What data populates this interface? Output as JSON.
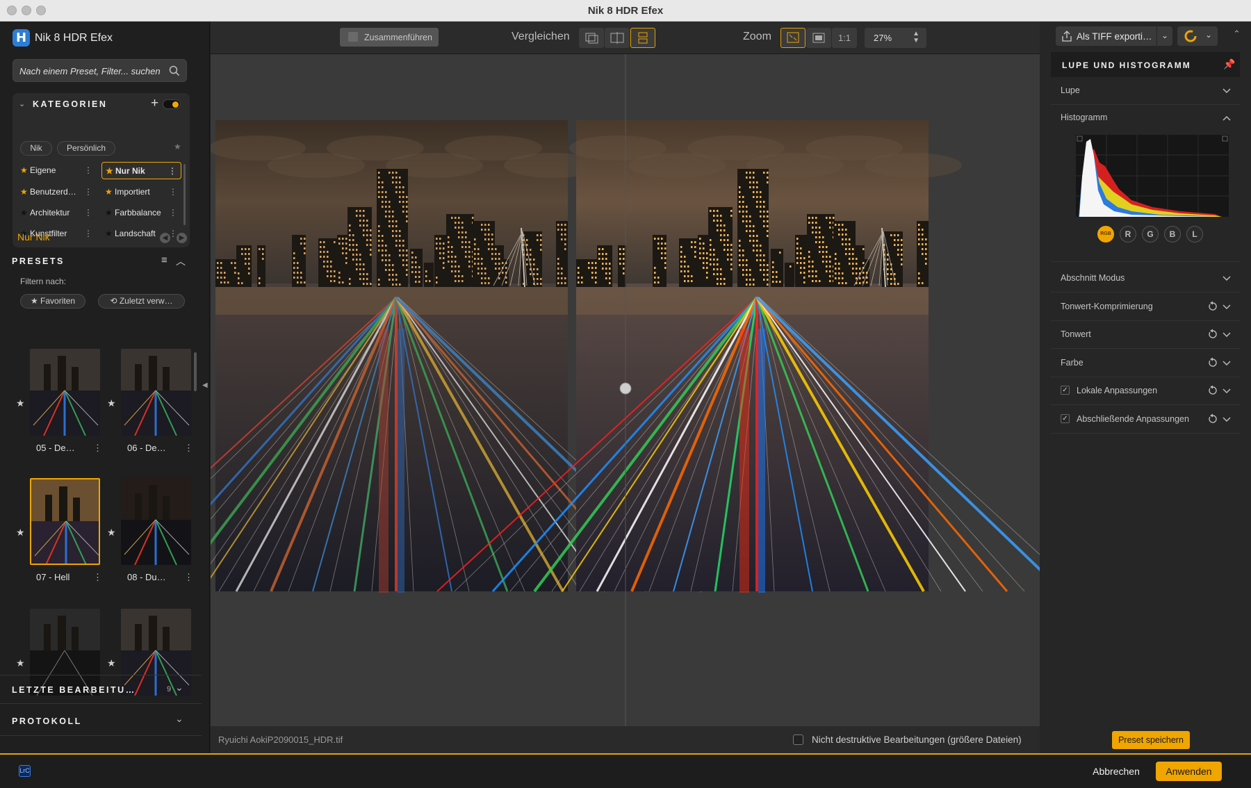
{
  "window": {
    "title": "Nik 8 HDR Efex"
  },
  "app": {
    "name": "Nik 8 HDR Efex",
    "logo_letter": "H"
  },
  "search": {
    "placeholder": "Nach einem Preset, Filter... suchen"
  },
  "categories": {
    "title": "KATEGORIEN",
    "toggle_on": true,
    "filters": [
      "Nik",
      "Persönlich"
    ],
    "items": [
      {
        "label": "Eigene",
        "starred": true
      },
      {
        "label": "Nur Nik",
        "starred": true,
        "selected": true
      },
      {
        "label": "Benutzerd…",
        "starred": true
      },
      {
        "label": "Importiert",
        "starred": true
      },
      {
        "label": "Architektur",
        "starred": false
      },
      {
        "label": "Farbbalance",
        "starred": false
      },
      {
        "label": "Kunstfilter",
        "starred": false
      },
      {
        "label": "Landschaft",
        "starred": false
      }
    ]
  },
  "active_category": "Nur Nik",
  "presets": {
    "title": "PRESETS",
    "filter_by": "Filtern nach:",
    "favorites": "Favoriten",
    "recent": "Zuletzt verw…",
    "items": [
      {
        "label": "05 - De…",
        "variant": "default"
      },
      {
        "label": "06 - De…",
        "variant": "default"
      },
      {
        "label": "07 - Hell",
        "variant": "bright",
        "selected": true
      },
      {
        "label": "08 - Du…",
        "variant": "dark"
      },
      {
        "label": "",
        "variant": "mono"
      },
      {
        "label": "",
        "variant": "default"
      }
    ]
  },
  "recent_edits": {
    "title": "LETZTE BEARBEITU…",
    "count": "9"
  },
  "protocol": {
    "title": "PROTOKOLL"
  },
  "toolbar": {
    "merge": "Zusammenführen",
    "compare": "Vergleichen",
    "zoom": "Zoom",
    "one_to_one": "1:1",
    "zoom_value": "27%"
  },
  "footer": {
    "filename": "Ryuichi AokiP2090015_HDR.tif",
    "nondestructive": "Nicht destruktive Bearbeitungen (größere Dateien)"
  },
  "export": {
    "label": "Als TIFF exporti…"
  },
  "right_panel": {
    "title": "LUPE UND HISTOGRAMM",
    "loupe": "Lupe",
    "histogram": "Histogramm",
    "channels": [
      "RGB",
      "R",
      "G",
      "B",
      "L"
    ],
    "active_channel": "RGB",
    "sections": [
      {
        "label": "Abschnitt Modus",
        "reset": false,
        "checkbox": false
      },
      {
        "label": "Tonwert-Komprimierung",
        "reset": true,
        "checkbox": false
      },
      {
        "label": "Tonwert",
        "reset": true,
        "checkbox": false
      },
      {
        "label": "Farbe",
        "reset": true,
        "checkbox": false
      },
      {
        "label": "Lokale Anpassungen",
        "reset": true,
        "checkbox": true
      },
      {
        "label": "Abschließende Anpassungen",
        "reset": true,
        "checkbox": true
      }
    ],
    "save_preset": "Preset speichern"
  },
  "bottom": {
    "lrc": "LrC",
    "cancel": "Abbrechen",
    "apply": "Anwenden"
  },
  "colors": {
    "accent": "#f0a500",
    "selected_border": "#f0a500",
    "panel": "#1f1f1f"
  }
}
